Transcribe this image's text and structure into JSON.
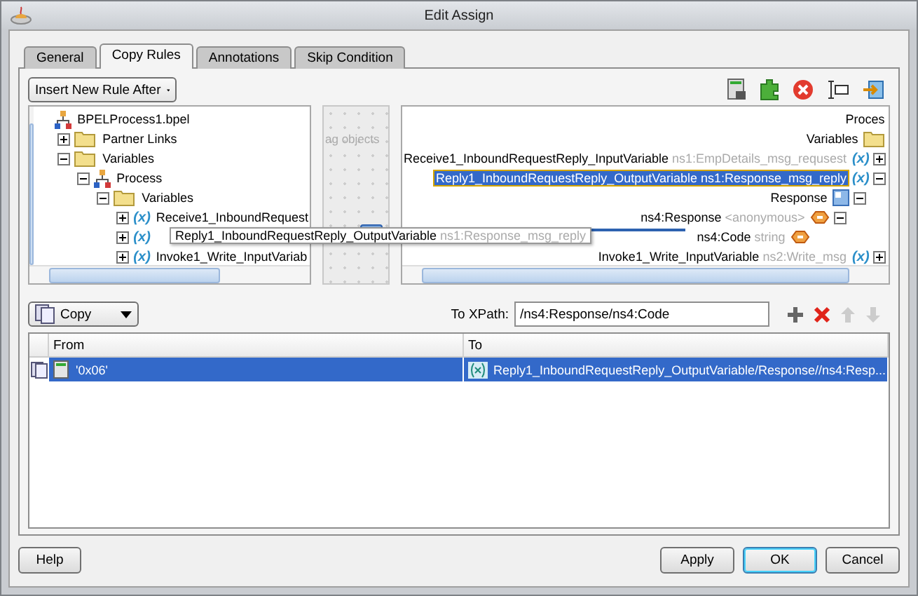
{
  "window": {
    "title": "Edit Assign"
  },
  "tabs": [
    {
      "label": "General",
      "selected": false
    },
    {
      "label": "Copy Rules",
      "selected": true
    },
    {
      "label": "Annotations",
      "selected": false
    },
    {
      "label": "Skip Condition",
      "selected": false
    }
  ],
  "rule_dropdown": {
    "value": "Insert New Rule After"
  },
  "source_tree": [
    {
      "label": "BPELProcess1.bpel",
      "kind": "process",
      "children": [
        {
          "label": "Partner Links",
          "kind": "folder",
          "expanded": false
        },
        {
          "label": "Variables",
          "kind": "folder",
          "expanded": true,
          "children": [
            {
              "label": "Process",
              "kind": "process",
              "expanded": true,
              "children": [
                {
                  "label": "Variables",
                  "kind": "folder",
                  "expanded": true,
                  "children": [
                    {
                      "label": "Receive1_InboundRequest",
                      "kind": "variable",
                      "badge": "(x)",
                      "expanded": false
                    },
                    {
                      "label": "Reply1_InboundRequestReply_OutputVariable",
                      "type": "ns1:Response_msg_reply",
                      "kind": "variable",
                      "badge": "(x)",
                      "expanded": false,
                      "hovered": true
                    },
                    {
                      "label": "Invoke1_Write_InputVariab",
                      "kind": "variable",
                      "badge": "(x)",
                      "expanded": false
                    }
                  ]
                }
              ]
            }
          ]
        }
      ]
    }
  ],
  "drop_area": {
    "hint": "ag objects"
  },
  "target_tree": [
    {
      "label": "Proces",
      "children": [
        {
          "label": "Variables",
          "kind": "folder",
          "children": [
            {
              "label": "Receive1_InboundRequestReply_InputVariable",
              "type": "ns1:EmpDetails_msg_requsest",
              "kind": "variable",
              "badge": "(x)",
              "expanded": false,
              "selected": false
            },
            {
              "label": "Reply1_InboundRequestReply_OutputVariable ns1:Response_msg_reply",
              "kind": "variable",
              "badge": "(x)",
              "expanded": true,
              "selected": true,
              "children": [
                {
                  "label": "Response",
                  "kind": "part",
                  "expanded": true,
                  "selected": false,
                  "children": [
                    {
                      "label": "ns4:Response",
                      "type": "<anonymous>",
                      "kind": "element",
                      "expanded": true,
                      "selected": false,
                      "children": [
                        {
                          "label": "ns4:Code",
                          "type": "string",
                          "kind": "element",
                          "selected": false,
                          "mapped": true
                        }
                      ]
                    }
                  ]
                }
              ]
            },
            {
              "label": "Invoke1_Write_InputVariable",
              "type": "ns2:Write_msg",
              "kind": "variable",
              "badge": "(x)",
              "expanded": false,
              "selected": false
            }
          ]
        }
      ]
    }
  ],
  "operation_dropdown": {
    "value": "Copy"
  },
  "xpath": {
    "label": "To XPath:",
    "value": "/ns4:Response/ns4:Code"
  },
  "table": {
    "columns": [
      "From",
      "To"
    ],
    "rows": [
      {
        "from": "'0x06'",
        "to": "Reply1_InboundRequestReply_OutputVariable/Response//ns4:Resp...",
        "selected": true
      }
    ]
  },
  "buttons": {
    "left": [
      "Help"
    ],
    "right": [
      {
        "label": "Apply",
        "default": false
      },
      {
        "label": "OK",
        "default": true
      },
      {
        "label": "Cancel",
        "default": false
      }
    ]
  }
}
